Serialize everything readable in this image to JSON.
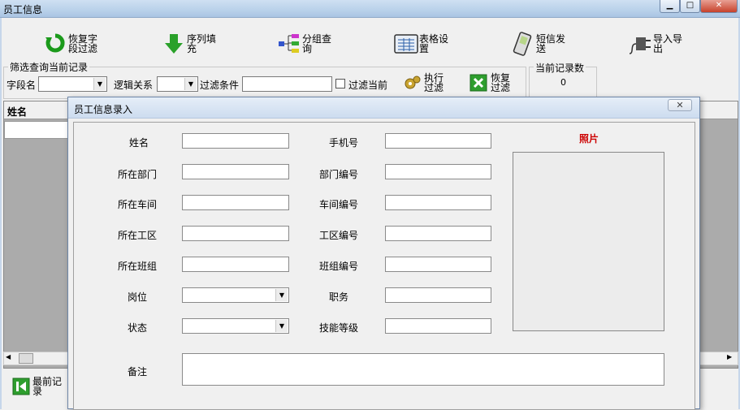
{
  "window": {
    "title": "员工信息"
  },
  "toolbar": {
    "items": [
      {
        "label": "恢复字段过滤",
        "icon": "restore-arrow-icon"
      },
      {
        "label": "序列填充",
        "icon": "down-arrow-icon"
      },
      {
        "label": "分组查询",
        "icon": "tree-group-icon"
      },
      {
        "label": "表格设置",
        "icon": "table-icon"
      },
      {
        "label": "短信发送",
        "icon": "phone-icon"
      },
      {
        "label": "导入导出",
        "icon": "plug-icon"
      }
    ]
  },
  "filter": {
    "legend": "筛选查询当前记录",
    "field_label": "字段名",
    "logic_label": "逻辑关系",
    "condition_label": "过滤条件",
    "filter_current_label": "过滤当前",
    "exec_label": "执行过滤",
    "restore_label": "恢复过滤"
  },
  "count": {
    "legend": "当前记录数",
    "value": "0"
  },
  "grid": {
    "first_column": "姓名"
  },
  "nav": {
    "first_record_label": "最前记录"
  },
  "dialog": {
    "title": "员工信息录入",
    "close": "✕",
    "photo_label": "照片",
    "fields_left": [
      "姓名",
      "所在部门",
      "所在车间",
      "所在工区",
      "所在班组",
      "岗位",
      "状态"
    ],
    "fields_right": [
      "手机号",
      "部门编号",
      "车间编号",
      "工区编号",
      "班组编号",
      "职务",
      "技能等级"
    ],
    "remark_label": "备注"
  },
  "colors": {
    "photo_label": "#cc0000",
    "accent_green": "#2e9e2e"
  }
}
